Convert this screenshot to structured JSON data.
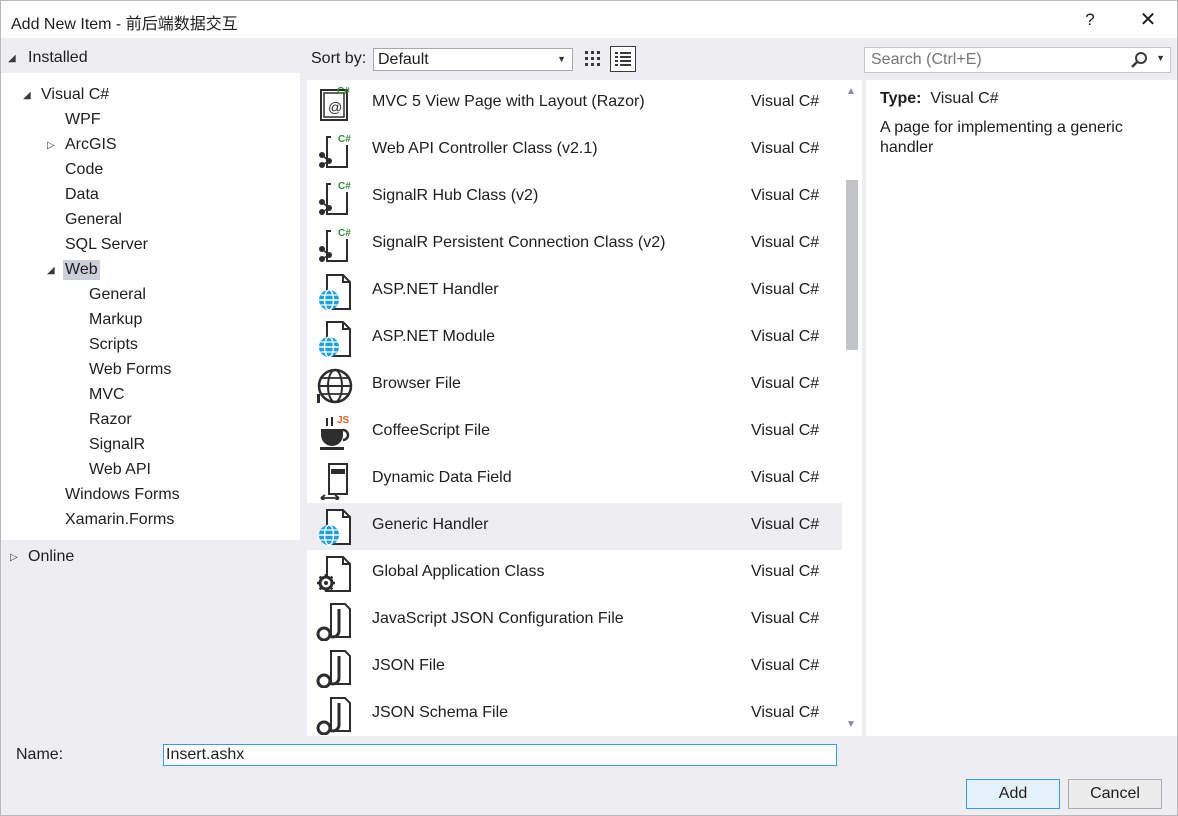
{
  "window": {
    "title": "Add New Item - 前后端数据交互",
    "help_label": "?",
    "close_label": "✕"
  },
  "left": {
    "installed_label": "Installed",
    "tree": [
      {
        "label": "Visual C#",
        "level": 0,
        "expander": "expanded",
        "selected": false
      },
      {
        "label": "WPF",
        "level": 1,
        "expander": "none",
        "selected": false
      },
      {
        "label": "ArcGIS",
        "level": 1,
        "expander": "collapsed",
        "selected": false
      },
      {
        "label": "Code",
        "level": 1,
        "expander": "none",
        "selected": false
      },
      {
        "label": "Data",
        "level": 1,
        "expander": "none",
        "selected": false
      },
      {
        "label": "General",
        "level": 1,
        "expander": "none",
        "selected": false
      },
      {
        "label": "SQL Server",
        "level": 1,
        "expander": "none",
        "selected": false
      },
      {
        "label": "Web",
        "level": 1,
        "expander": "expanded",
        "selected": true
      },
      {
        "label": "General",
        "level": 2,
        "expander": "none",
        "selected": false
      },
      {
        "label": "Markup",
        "level": 2,
        "expander": "none",
        "selected": false
      },
      {
        "label": "Scripts",
        "level": 2,
        "expander": "none",
        "selected": false
      },
      {
        "label": "Web Forms",
        "level": 2,
        "expander": "none",
        "selected": false
      },
      {
        "label": "MVC",
        "level": 2,
        "expander": "none",
        "selected": false
      },
      {
        "label": "Razor",
        "level": 2,
        "expander": "none",
        "selected": false
      },
      {
        "label": "SignalR",
        "level": 2,
        "expander": "none",
        "selected": false
      },
      {
        "label": "Web API",
        "level": 2,
        "expander": "none",
        "selected": false
      },
      {
        "label": "Windows Forms",
        "level": 1,
        "expander": "none",
        "selected": false
      },
      {
        "label": "Xamarin.Forms",
        "level": 1,
        "expander": "none",
        "selected": false
      }
    ],
    "online_label": "Online"
  },
  "toolbar": {
    "sort_label": "Sort by:",
    "sort_value": "Default",
    "search_placeholder": "Search (Ctrl+E)"
  },
  "items": [
    {
      "name": "MVC 5 View Page with Layout (Razor)",
      "lang": "Visual C#",
      "icon": "razor-page-icon",
      "selected": false
    },
    {
      "name": "Web API Controller Class (v2.1)",
      "lang": "Visual C#",
      "icon": "csharp-class-icon",
      "selected": false
    },
    {
      "name": "SignalR Hub Class (v2)",
      "lang": "Visual C#",
      "icon": "csharp-class-icon",
      "selected": false
    },
    {
      "name": "SignalR Persistent Connection Class (v2)",
      "lang": "Visual C#",
      "icon": "csharp-class-icon",
      "selected": false
    },
    {
      "name": "ASP.NET Handler",
      "lang": "Visual C#",
      "icon": "globe-file-icon",
      "selected": false
    },
    {
      "name": "ASP.NET Module",
      "lang": "Visual C#",
      "icon": "globe-file-icon",
      "selected": false
    },
    {
      "name": "Browser File",
      "lang": "Visual C#",
      "icon": "browser-globe-icon",
      "selected": false
    },
    {
      "name": "CoffeeScript File",
      "lang": "Visual C#",
      "icon": "coffee-cup-icon",
      "selected": false
    },
    {
      "name": "Dynamic Data Field",
      "lang": "Visual C#",
      "icon": "data-field-icon",
      "selected": false
    },
    {
      "name": "Generic Handler",
      "lang": "Visual C#",
      "icon": "globe-file-icon",
      "selected": true
    },
    {
      "name": "Global Application Class",
      "lang": "Visual C#",
      "icon": "gear-file-icon",
      "selected": false
    },
    {
      "name": "JavaScript JSON Configuration File",
      "lang": "Visual C#",
      "icon": "json-file-icon",
      "selected": false
    },
    {
      "name": "JSON File",
      "lang": "Visual C#",
      "icon": "json-file-icon",
      "selected": false
    },
    {
      "name": "JSON Schema File",
      "lang": "Visual C#",
      "icon": "json-file-icon",
      "selected": false
    }
  ],
  "details": {
    "type_label": "Type:",
    "type_value": "Visual C#",
    "description": "A page for implementing a generic handler"
  },
  "bottom": {
    "name_label": "Name:",
    "name_value": "Insert.ashx",
    "add_label": "Add",
    "cancel_label": "Cancel"
  },
  "colors": {
    "selection": "#cccedb",
    "csharp_green": "#388a34",
    "globe_blue": "#1ba1e2",
    "coffee_orange": "#e8601a"
  }
}
